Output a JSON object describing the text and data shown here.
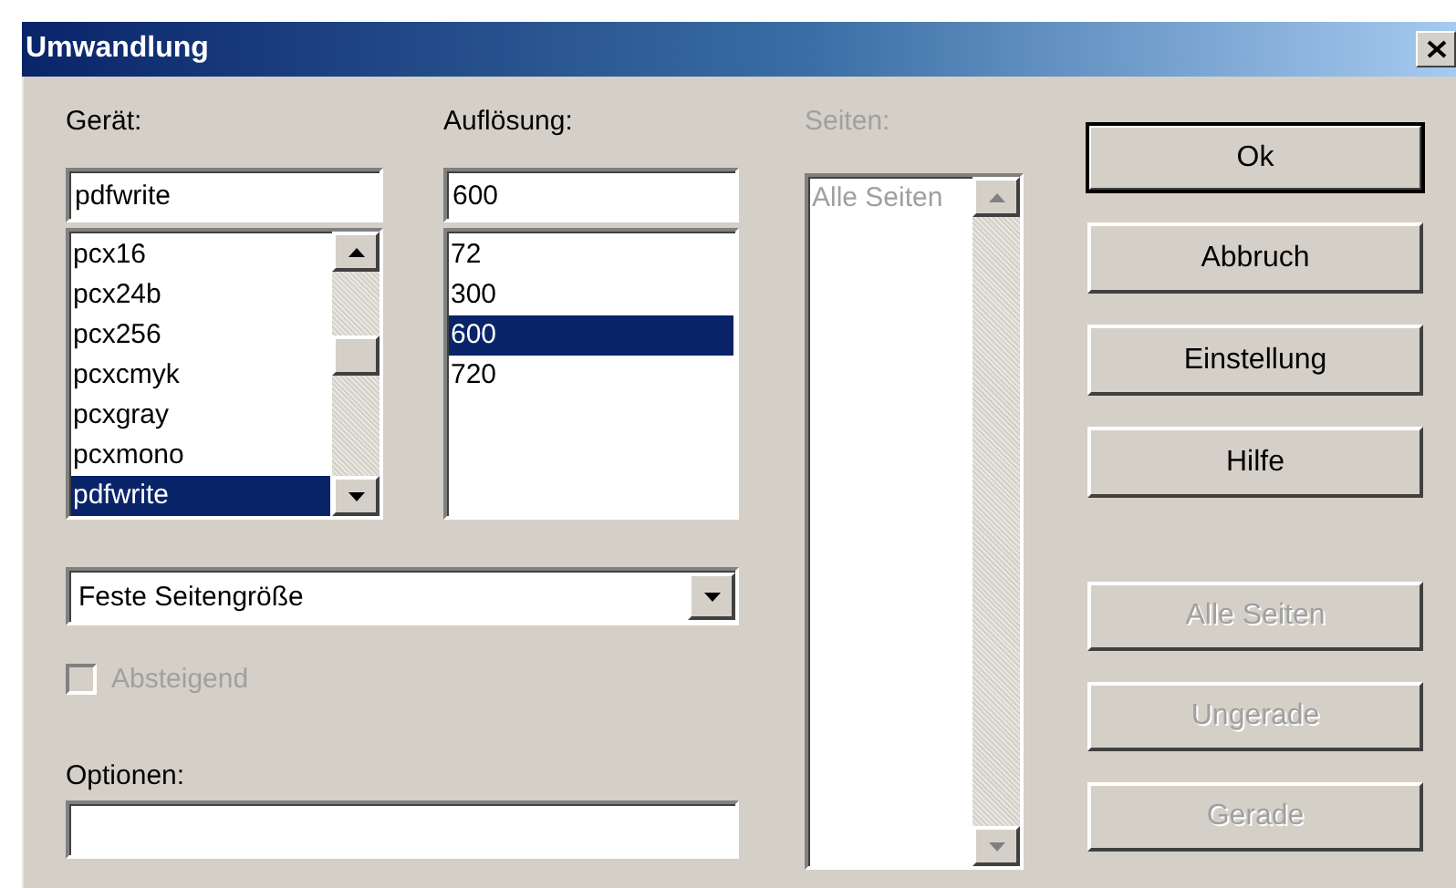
{
  "window": {
    "title": "Umwandlung"
  },
  "device": {
    "label": "Gerät:",
    "value": "pdfwrite",
    "items": [
      {
        "text": "pcx16",
        "selected": false
      },
      {
        "text": "pcx24b",
        "selected": false
      },
      {
        "text": "pcx256",
        "selected": false
      },
      {
        "text": "pcxcmyk",
        "selected": false
      },
      {
        "text": "pcxgray",
        "selected": false
      },
      {
        "text": "pcxmono",
        "selected": false
      },
      {
        "text": "pdfwrite",
        "selected": true
      }
    ]
  },
  "resolution": {
    "label": "Auflösung:",
    "value": "600",
    "items": [
      {
        "text": "72",
        "selected": false
      },
      {
        "text": "300",
        "selected": false
      },
      {
        "text": "600",
        "selected": true
      },
      {
        "text": "720",
        "selected": false
      }
    ]
  },
  "pages": {
    "label": "Seiten:",
    "disabled": true,
    "items": [
      {
        "text": "Alle Seiten",
        "selected": false
      }
    ]
  },
  "page_size": {
    "value": "Feste Seitengröße"
  },
  "descending": {
    "label": "Absteigend",
    "checked": false,
    "disabled": true
  },
  "options": {
    "label": "Optionen:"
  },
  "buttons": [
    {
      "label": "Ok",
      "default": true,
      "disabled": false
    },
    {
      "label": "Abbruch",
      "default": false,
      "disabled": false
    },
    {
      "label": "Einstellung",
      "default": false,
      "disabled": false
    },
    {
      "label": "Hilfe",
      "default": false,
      "disabled": false
    }
  ],
  "page_buttons": [
    {
      "label": "Alle Seiten",
      "disabled": true
    },
    {
      "label": "Ungerade",
      "disabled": true
    },
    {
      "label": "Gerade",
      "disabled": true
    }
  ]
}
